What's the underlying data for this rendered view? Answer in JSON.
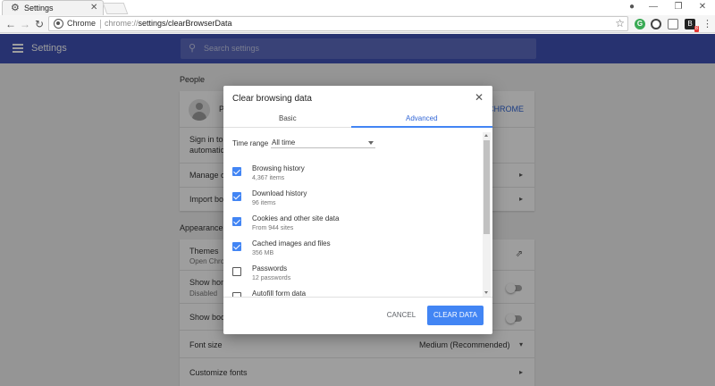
{
  "browser": {
    "tab_title": "Settings",
    "chip": "Chrome",
    "url_prefix": "chrome://",
    "url_path": "settings/clearBrowserData",
    "ext_g": "G",
    "ext_b": "B",
    "ext_b_badge": "8"
  },
  "header": {
    "title": "Settings",
    "search_placeholder": "Search settings"
  },
  "background": {
    "people_section": "People",
    "people_name": "P",
    "people_action": "D CHROME",
    "signin_line1": "Sign in to g",
    "signin_line2": "automatica",
    "manage": "Manage ot",
    "import": "Import boo",
    "appearance_section": "Appearance",
    "themes": "Themes",
    "themes_sub": "Open Chron",
    "show_home": "Show home",
    "show_home_sub": "Disabled",
    "show_bookmarks": "Show book",
    "font_size": "Font size",
    "font_size_value": "Medium (Recommended)",
    "customize_fonts": "Customize fonts"
  },
  "dialog": {
    "title": "Clear browsing data",
    "tabs": {
      "basic": "Basic",
      "advanced": "Advanced"
    },
    "time_range_label": "Time range",
    "time_range_value": "All time",
    "items": [
      {
        "name": "Browsing history",
        "detail": "4,367 items",
        "checked": true
      },
      {
        "name": "Download history",
        "detail": "96 items",
        "checked": true
      },
      {
        "name": "Cookies and other site data",
        "detail": "From 944 sites",
        "checked": true
      },
      {
        "name": "Cached images and files",
        "detail": "356 MB",
        "checked": true
      },
      {
        "name": "Passwords",
        "detail": "12 passwords",
        "checked": false
      },
      {
        "name": "Autofill form data",
        "detail": "",
        "checked": false
      }
    ],
    "cancel_label": "CANCEL",
    "clear_label": "CLEAR DATA"
  },
  "colors": {
    "header": "#3f51b5",
    "accent": "#4285f4"
  }
}
